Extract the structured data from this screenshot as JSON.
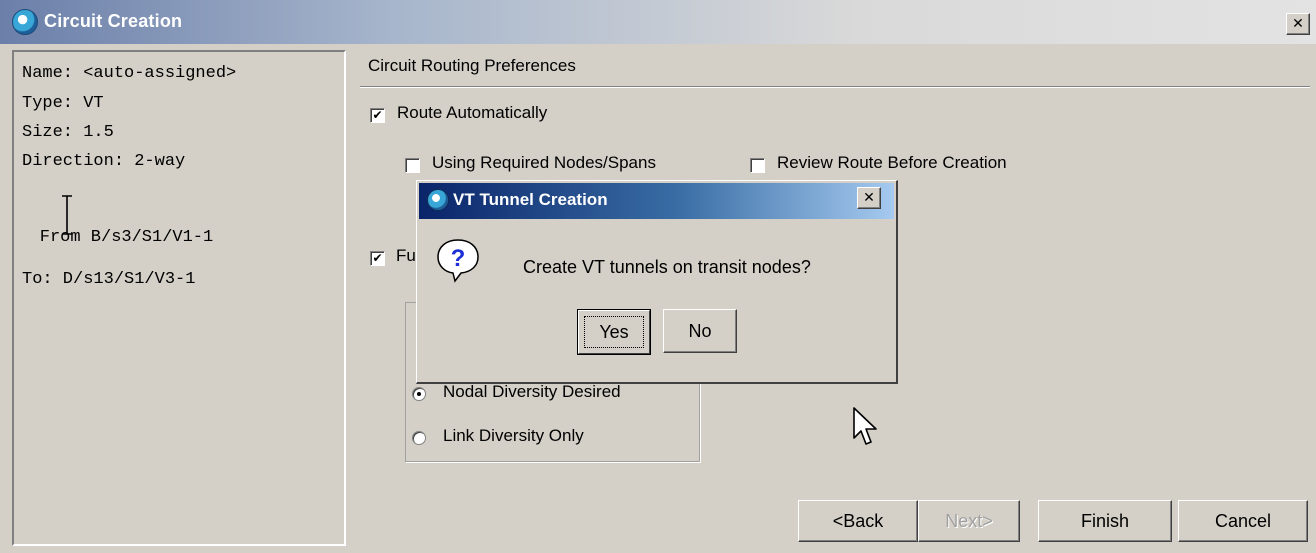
{
  "window": {
    "title": "Circuit Creation",
    "close_glyph": "✕",
    "icon": "circuit-app-icon"
  },
  "info": {
    "name": "Name: <auto-assigned>",
    "type": "Type: VT",
    "size": "Size: 1.5",
    "direction": "Direction: 2-way",
    "from_prefix": "From",
    "from_value": " B/s3/S1/V1-1",
    "to": "To: D/s13/S1/V3-1"
  },
  "routing": {
    "section_title": "Circuit Routing Preferences",
    "route_automatically": {
      "label": "Route Automatically",
      "checked": true
    },
    "using_required_nodes": {
      "label": "Using Required Nodes/Spans",
      "checked": false
    },
    "review_route": {
      "label": "Review Route Before Creation",
      "checked": false
    },
    "fully_protected": {
      "label": "Fu",
      "checked": true
    },
    "diversity": {
      "nodal": {
        "label": "Nodal Diversity Desired",
        "selected": true
      },
      "link": {
        "label": "Link Diversity Only",
        "selected": false
      }
    }
  },
  "buttons": {
    "back": "<Back",
    "next": "Next>",
    "finish": "Finish",
    "cancel": "Cancel"
  },
  "dialog": {
    "title": "VT Tunnel Creation",
    "close_glyph": "✕",
    "message": "Create VT tunnels on transit nodes?",
    "yes": "Yes",
    "no": "No",
    "icon": "question-icon"
  },
  "colors": {
    "window_bg": "#d4d0c8",
    "dialog_title_start": "#0a246a",
    "dialog_title_end": "#a6caf0",
    "question_blue": "#1c2fd6"
  }
}
